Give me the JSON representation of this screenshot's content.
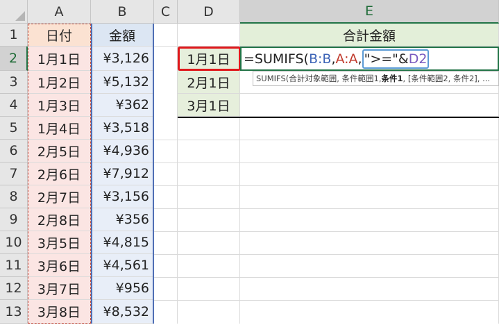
{
  "columns": [
    "A",
    "B",
    "C",
    "D",
    "E"
  ],
  "rows": [
    "1",
    "2",
    "3",
    "4",
    "5",
    "6",
    "7",
    "8",
    "9",
    "10",
    "11",
    "12",
    "13"
  ],
  "headers": {
    "date": "日付",
    "amount": "金額",
    "total": "合計金額"
  },
  "dates": [
    "1月1日",
    "1月2日",
    "1月3日",
    "1月4日",
    "2月5日",
    "2月6日",
    "2月7日",
    "2月8日",
    "3月5日",
    "3月6日",
    "3月7日",
    "3月8日"
  ],
  "amounts": [
    "¥3,126",
    "¥5,132",
    "¥362",
    "¥3,518",
    "¥4,936",
    "¥7,912",
    "¥3,156",
    "¥356",
    "¥4,815",
    "¥4,561",
    "¥956",
    "¥8,532"
  ],
  "criteria": [
    "1月1日",
    "2月1日",
    "3月1日"
  ],
  "formula": {
    "prefix": "=SUMIFS(",
    "ref1": "B:B",
    "sep1": ",",
    "ref2": "A:A",
    "sep2": ",",
    "op": "\">=\"&",
    "ref3": "D2"
  },
  "tooltip": {
    "fn": "SUMIFS(合計対象範囲, 条件範囲1, ",
    "bold": "条件1",
    "rest": ", [条件範囲2, 条件2], ..."
  },
  "colors": {
    "formula_ref_blue": "#3d64b7",
    "formula_ref_red": "#c0392b",
    "formula_ref_purple": "#7a5bbf",
    "selection_green": "#217346",
    "highlight_red": "#e0181b"
  }
}
